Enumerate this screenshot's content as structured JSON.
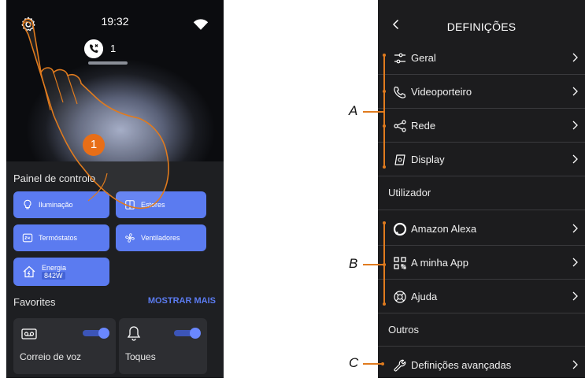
{
  "left": {
    "status": {
      "time": "19:32",
      "call_count": "1"
    },
    "panel_title": "Painel de controlo",
    "tiles": [
      {
        "label": "Iluminação",
        "icon": "bulb-icon"
      },
      {
        "label": "Estores",
        "icon": "shutter-icon"
      },
      {
        "label": "Termóstatos",
        "icon": "thermostat-icon"
      },
      {
        "label": "Ventiladores",
        "icon": "fan-icon"
      },
      {
        "label": "Energia",
        "value": "842W",
        "icon": "energy-icon"
      }
    ],
    "favorites_title": "Favorites",
    "show_more": "MOSTRAR MAIS",
    "favorites": [
      {
        "label": "Correio de voz",
        "icon": "voicemail-icon",
        "enabled": true
      },
      {
        "label": "Toques",
        "icon": "bell-icon",
        "enabled": true
      }
    ],
    "callout_number": "1"
  },
  "right": {
    "title": "DEFINIÇÕES",
    "rows_group_a": [
      {
        "label": "Geral",
        "icon": "sliders-icon"
      },
      {
        "label": "Videoporteiro",
        "icon": "phone-icon"
      },
      {
        "label": "Rede",
        "icon": "share-icon"
      },
      {
        "label": "Display",
        "icon": "display-icon"
      }
    ],
    "section_user": "Utilizador",
    "rows_group_b": [
      {
        "label": "Amazon Alexa",
        "icon": "alexa-icon"
      },
      {
        "label": "A minha App",
        "icon": "qr-icon"
      },
      {
        "label": "Ajuda",
        "icon": "lifebuoy-icon"
      }
    ],
    "section_other": "Outros",
    "rows_group_c": [
      {
        "label": "Definições avançadas",
        "icon": "wrench-icon"
      }
    ]
  },
  "annotations": {
    "a": "A",
    "b": "B",
    "c": "C"
  },
  "colors": {
    "accent": "#5b7bf0",
    "callout": "#e86e17",
    "bracket": "#e07b1e"
  }
}
